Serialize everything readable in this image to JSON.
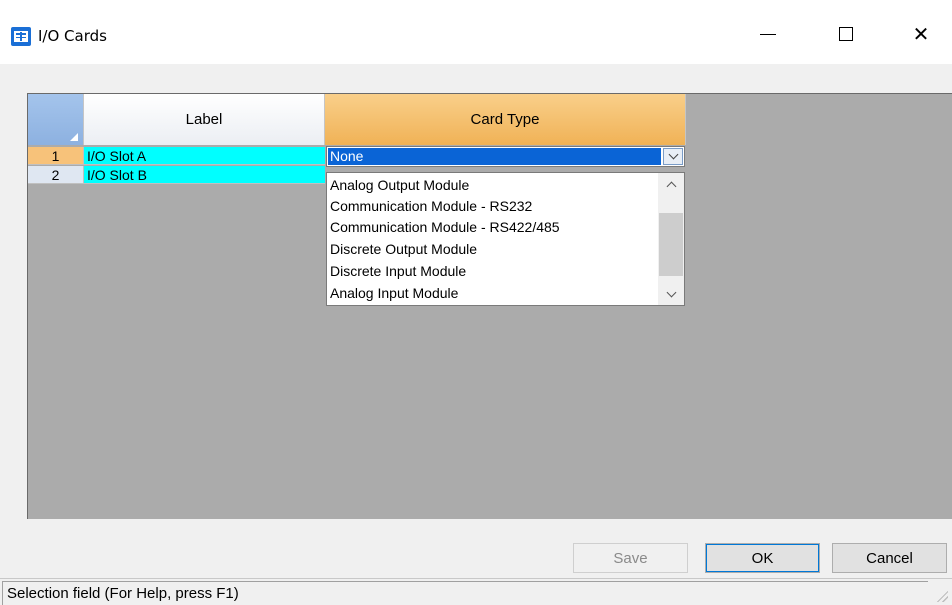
{
  "window": {
    "title": "I/O Cards",
    "icon": "grid-app-icon"
  },
  "grid": {
    "columns": [
      "Label",
      "Card Type"
    ],
    "rows": [
      {
        "num": "1",
        "label": "I/O Slot A"
      },
      {
        "num": "2",
        "label": "I/O Slot B"
      }
    ],
    "label_cell_color": "#00ffff",
    "active_header_color": "#f0b256"
  },
  "dropdown": {
    "selected": "None",
    "options": [
      "Analog Output Module",
      "Communication Module - RS232",
      "Communication Module - RS422/485",
      "Discrete Output Module",
      "Discrete Input Module",
      "Analog Input Module"
    ]
  },
  "buttons": {
    "save": "Save",
    "ok": "OK",
    "cancel": "Cancel"
  },
  "status": {
    "text": "Selection field (For Help, press F1)"
  }
}
